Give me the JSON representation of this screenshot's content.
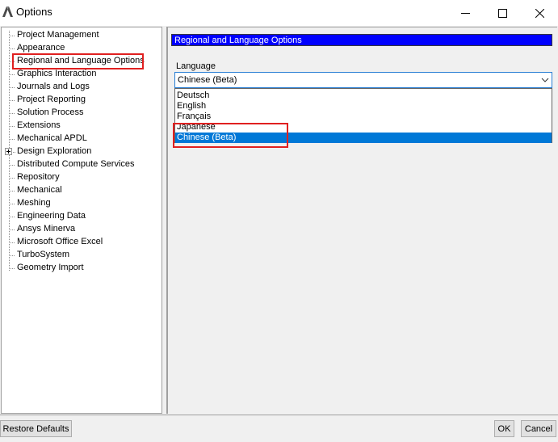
{
  "window": {
    "title": "Options"
  },
  "tree": {
    "items": [
      {
        "label": "Project Management"
      },
      {
        "label": "Appearance"
      },
      {
        "label": "Regional and Language Options"
      },
      {
        "label": "Graphics Interaction"
      },
      {
        "label": "Journals and Logs"
      },
      {
        "label": "Project Reporting"
      },
      {
        "label": "Solution Process"
      },
      {
        "label": "Extensions"
      },
      {
        "label": "Mechanical APDL"
      },
      {
        "label": "Design Exploration",
        "expandable": true
      },
      {
        "label": "Distributed Compute Services"
      },
      {
        "label": "Repository"
      },
      {
        "label": "Mechanical"
      },
      {
        "label": "Meshing"
      },
      {
        "label": "Engineering Data"
      },
      {
        "label": "Ansys Minerva"
      },
      {
        "label": "Microsoft Office Excel"
      },
      {
        "label": "TurboSystem"
      },
      {
        "label": "Geometry Import"
      }
    ],
    "selected": "Regional and Language Options"
  },
  "panel": {
    "header": "Regional and Language Options",
    "language_label": "Language",
    "combo_value": "Chinese (Beta)",
    "options": [
      "Deutsch",
      "English",
      "Français",
      "Japanese",
      "Chinese (Beta)"
    ],
    "selected_option": "Chinese (Beta)"
  },
  "buttons": {
    "restore": "Restore Defaults",
    "ok": "OK",
    "cancel": "Cancel"
  },
  "colors": {
    "header_bg": "#0000ff",
    "selection_bg": "#0078d7",
    "highlight_box": "#e02020"
  }
}
